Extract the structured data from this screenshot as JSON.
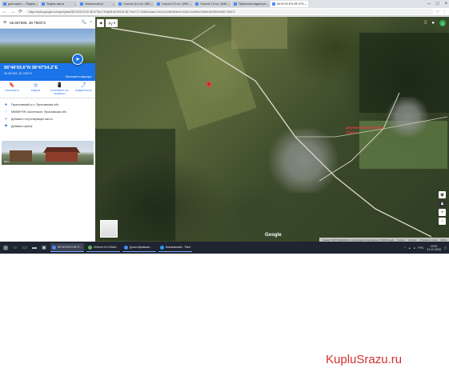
{
  "browser": {
    "tabs": [
      {
        "label": "дом карты — Яндекс.карт",
        "active": false
      },
      {
        "label": "Яндекс карты",
        "active": false
      },
      {
        "label": "Земельный уч.",
        "active": false
      },
      {
        "label": "Участок (10 сот. ИЖС)",
        "active": false
      },
      {
        "label": "Участок 10 сот. (ИЖС)",
        "active": false
      },
      {
        "label": "Участок 10 сот. (ИЖС)",
        "active": false
      },
      {
        "label": "Публичная кадастровая",
        "active": false
      },
      {
        "label": "56°40'03.6\"N 38°47'54.2",
        "active": true
      }
    ],
    "url": "https://www.google.ru/maps/place/56°40'03.6\"N+38°47'54.2\"E/@56.6676519,38.7942717,2530m/data=!3m1!1e3!4m5!3m4!1s0x0:0x0!8m2!3d56.667659!4d38.798372"
  },
  "panel": {
    "search_value": "56.667659, 38.798372",
    "coords_title": "56°40'03.6\"N 38°47'54.2\"E",
    "coords_sub": "56.667659, 38.798372",
    "route_label": "Проложить маршрут",
    "actions": [
      {
        "icon": "save-icon",
        "glyph": "🔖",
        "label": "СОХРАНИТЬ"
      },
      {
        "icon": "nearby-icon",
        "glyph": "◎",
        "label": "РЯДОМ"
      },
      {
        "icon": "send-to-phone-icon",
        "glyph": "📱",
        "label": "ОТПРАВИТЬ НА ТЕЛЕФОН"
      },
      {
        "icon": "share-icon",
        "glyph": "⤴",
        "label": "ПОДЕЛИТЬСЯ"
      }
    ],
    "info": [
      {
        "icon": "place-icon",
        "glyph": "●",
        "text": "Переславский р-н, Ярославская обл."
      },
      {
        "icon": "plus-code-icon",
        "glyph": "⁘",
        "text": "MMM8+FW Смоленское, Ярославская обл."
      },
      {
        "icon": "add-place-icon",
        "glyph": "+",
        "text": "Добавить отсутствующее место"
      },
      {
        "icon": "flag-icon",
        "glyph": "⚑",
        "text": "Добавить ярлык"
      }
    ],
    "photo_caption": "Фото"
  },
  "map": {
    "type_select": "Ру",
    "red_label_line1": "Деревня Смоленское",
    "red_label_line2": "Озеро",
    "google_logo": "Google",
    "footer": [
      "Снимки ©2018 DigitalGlobe, Картографические данные ©2018 Google",
      "Россия",
      "Условия",
      "Отправить отзыв",
      "200 м"
    ]
  },
  "taskbar": {
    "apps": [
      {
        "label": "56°40'03.6\"N 38°47'...",
        "color": "#4a8af4",
        "active": true
      },
      {
        "label": "uTorrent 3.5.4 Build...",
        "color": "#5cb85c",
        "active": false
      },
      {
        "label": "Дочка Абрамова...",
        "color": "#4a8af4",
        "active": false
      },
      {
        "label": "Безымянный1 - Paint",
        "color": "#2d9bf0",
        "active": false
      }
    ],
    "lang": "РУС",
    "time": "19:20",
    "date": "21.11.2018"
  },
  "watermark": "KupluSrazu.ru"
}
